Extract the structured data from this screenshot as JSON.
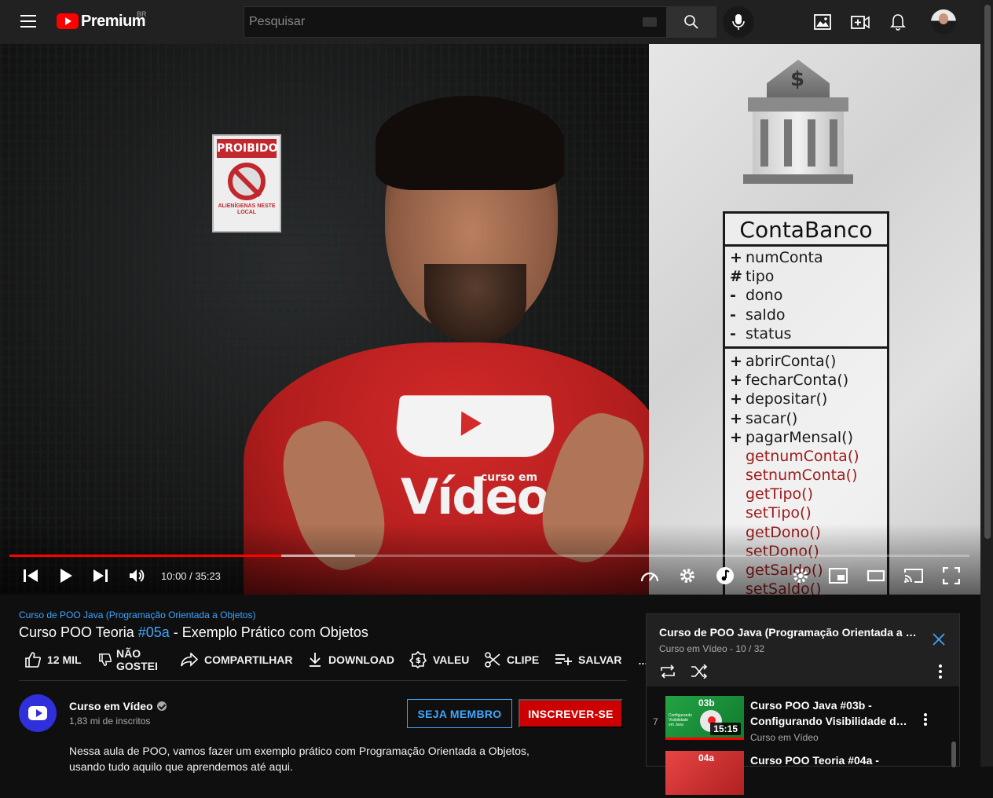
{
  "header": {
    "logo_text": "Premium",
    "logo_region": "BR",
    "search_placeholder": "Pesquisar"
  },
  "player": {
    "time_display": "10:00 / 35:23",
    "progress_played": 0.283,
    "progress_buffered": 0.36,
    "video_overlay": {
      "sign_title": "PROIBIDO",
      "sign_subtitle": "ALIENÍGENAS NESTE LOCAL",
      "shirt_brand_small": "curso em",
      "shirt_brand_large": "Vídeo",
      "uml_class_name": "ContaBanco",
      "uml_attributes": [
        {
          "vis": "+",
          "name": "numConta"
        },
        {
          "vis": "#",
          "name": "tipo"
        },
        {
          "vis": "-",
          "name": "dono"
        },
        {
          "vis": "-",
          "name": "saldo"
        },
        {
          "vis": "-",
          "name": "status"
        }
      ],
      "uml_methods": [
        {
          "vis": "+",
          "name": "abrirConta()"
        },
        {
          "vis": "+",
          "name": "fecharConta()"
        },
        {
          "vis": "+",
          "name": "depositar()"
        },
        {
          "vis": "+",
          "name": "sacar()"
        },
        {
          "vis": "+",
          "name": "pagarMensal()"
        },
        {
          "vis": "",
          "name": "getnumConta()"
        },
        {
          "vis": "",
          "name": "setnumConta()"
        },
        {
          "vis": "",
          "name": "getTipo()"
        },
        {
          "vis": "",
          "name": "setTipo()"
        },
        {
          "vis": "",
          "name": "getDono()"
        },
        {
          "vis": "",
          "name": "setDono()"
        },
        {
          "vis": "",
          "name": "getSaldo()"
        },
        {
          "vis": "",
          "name": "setSaldo()"
        }
      ]
    }
  },
  "video": {
    "playlist_link": "Curso de POO Java (Programação Orientada a Objetos)",
    "title_prefix": "Curso POO Teoria ",
    "title_hashtag": "#05a",
    "title_suffix": " - Exemplo Prático com Objetos",
    "likes": "12 MIL",
    "dislike_label_1": "NÃO",
    "dislike_label_2": "GOSTEI",
    "share_label": "COMPARTILHAR",
    "download_label": "DOWNLOAD",
    "thanks_label": "VALEU",
    "clip_label": "CLIPE",
    "save_label": "SALVAR",
    "more_label": "..."
  },
  "channel": {
    "name": "Curso em Vídeo",
    "subscribers": "1,83 mi de inscritos",
    "member_button": "SEJA MEMBRO",
    "subscribe_button": "INSCREVER-SE",
    "description_line1": "Nessa aula de POO, vamos fazer um exemplo prático com Programação Orientada a Objetos,",
    "description_line2": "usando tudo aquilo que aprendemos até aqui."
  },
  "playlist": {
    "title": "Curso de POO Java (Programação Orientada a Objetos)",
    "subtitle": "Curso em Vídeo - 10 / 32",
    "items": [
      {
        "index": "7",
        "thumb_number": "03b",
        "thumb_text": "Configurando Visibilidade em Java",
        "duration": "15:15",
        "title_line1": "Curso POO Java #03b -",
        "title_line2": "Configurando Visibilidade de Atributos e Métodos",
        "channel": "Curso em Vídeo"
      },
      {
        "index": "",
        "thumb_number": "04a",
        "title_line1": "Curso POO Teoria #04a -"
      }
    ]
  },
  "colors": {
    "accent_blue": "#3ea6ff",
    "brand_red": "#ff0000",
    "subscribe_red": "#cc0000",
    "background": "#0f0f0f",
    "header": "#212121"
  },
  "icons": {
    "menu": "hamburger-icon",
    "search": "search-icon",
    "voice": "mic-icon",
    "create": "create-video-icon",
    "apps": "image-icon",
    "notifications": "bell-icon"
  }
}
